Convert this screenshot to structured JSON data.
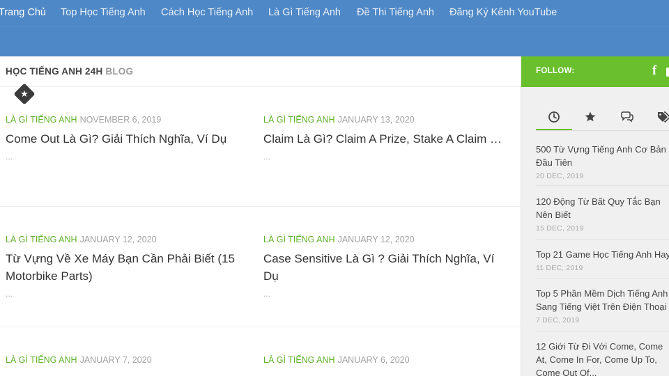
{
  "nav": {
    "items": [
      {
        "label": "Trang Chủ",
        "active": true
      },
      {
        "label": "Top Học Tiếng Anh"
      },
      {
        "label": "Cách Học Tiếng Anh"
      },
      {
        "label": "Là Gì Tiếng Anh"
      },
      {
        "label": "Đề Thi Tiếng Anh"
      },
      {
        "label": "Đăng Ký Kênh YouTube"
      }
    ]
  },
  "blog": {
    "title_strong": "HỌC TIẾNG ANH 24H",
    "title_light": "BLOG"
  },
  "icons": {
    "sticky": "star-icon",
    "tabs": [
      "clock-icon",
      "star-icon",
      "comments-icon",
      "tags-icon"
    ],
    "social": "facebook-icon"
  },
  "colors": {
    "nav_bg": "#4f88c6",
    "accent_green": "#6abf2d",
    "category_green": "#5fb22a"
  },
  "posts": [
    {
      "category": "LÀ GÌ TIẾNG ANH",
      "date": "NOVEMBER 6, 2019",
      "title": "Come Out Là Gì? Giải Thích Nghĩa, Ví Dụ",
      "excerpt": "..."
    },
    {
      "category": "LÀ GÌ TIẾNG ANH",
      "date": "JANUARY 13, 2020",
      "title": "Claim Là Gì? Claim A Prize, Stake A Claim …",
      "excerpt": "..."
    },
    {
      "category": "LÀ GÌ TIẾNG ANH",
      "date": "JANUARY 12, 2020",
      "title": "Từ Vựng Về Xe Máy Bạn Cần Phải Biết (15 Motorbike Parts)",
      "excerpt": "..."
    },
    {
      "category": "LÀ GÌ TIẾNG ANH",
      "date": "JANUARY 12, 2020",
      "title": "Case Sensitive Là Gì ? Giải Thích Nghĩa, Ví Dụ",
      "excerpt": "..."
    },
    {
      "category": "LÀ GÌ TIẾNG ANH",
      "date": "JANUARY 7, 2020",
      "title": "",
      "excerpt": ""
    },
    {
      "category": "LÀ GÌ TIẾNG ANH",
      "date": "JANUARY 6, 2020",
      "title": "",
      "excerpt": ""
    }
  ],
  "sidebar": {
    "follow_label": "FOLLOW:",
    "items": [
      {
        "lines": [
          "500 Từ Vựng Tiếng Anh Cơ Bản",
          "Đầu Tiên"
        ],
        "date": "20 DEC, 2019"
      },
      {
        "lines": [
          "120 Động Từ Bất Quy Tắc Bạn",
          "Nên Biết"
        ],
        "date": "15 DEC, 2019"
      },
      {
        "lines": [
          "Top 21 Game Học Tiếng Anh Hay"
        ],
        "date": "11 DEC, 2019"
      },
      {
        "lines": [
          "Top 5 Phần Mềm Dịch Tiếng Anh",
          "Sang Tiếng Việt Trên Điện Thoại"
        ],
        "date": "7 DEC, 2019"
      },
      {
        "lines": [
          "12 Giới Từ Đi Với Come, Come",
          "At, Come In For, Come Up To,",
          "Come Out Of..."
        ],
        "date": ""
      }
    ]
  }
}
